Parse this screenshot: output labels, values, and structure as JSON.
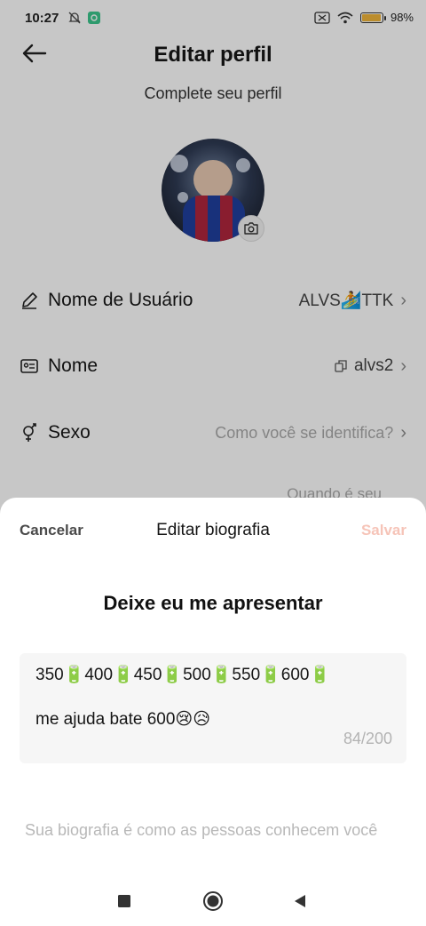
{
  "status_bar": {
    "time": "10:27",
    "battery": "98%",
    "battery_level": 0.98,
    "icons": [
      "mute-bell-icon",
      "app-notification-icon",
      "screen-icon",
      "wifi-icon",
      "battery-icon"
    ]
  },
  "header": {
    "title": "Editar perfil",
    "subtitle": "Complete seu perfil",
    "back_icon": "arrow-left-icon"
  },
  "profile": {
    "camera_icon": "camera-icon",
    "rows": [
      {
        "icon": "pencil-icon",
        "label": "Nome de Usuário",
        "value": "ALVS🏄TTK"
      },
      {
        "icon": "id-card-icon",
        "label": "Nome",
        "value": "alvs2",
        "value_icon": "copy-icon"
      },
      {
        "icon": "gender-icon",
        "label": "Sexo",
        "value": "Como você se identifica?"
      }
    ],
    "partial_row_text": "Quando é seu"
  },
  "sheet": {
    "cancel_label": "Cancelar",
    "title": "Editar biografia",
    "save_label": "Salvar",
    "heading": "Deixe eu me apresentar",
    "bio_line1": "350🔋400🔋450🔋500🔋550🔋600🔋",
    "bio_line2": "me ajuda bate 600😢😥",
    "counter": "84/200",
    "hint": "Sua biografia é como as pessoas conhecem você"
  },
  "nav": {
    "icons": [
      "recent-apps-icon",
      "home-icon",
      "back-icon"
    ]
  },
  "colors": {
    "save_disabled": "#f6c4b8",
    "battery": "#f0b53c"
  }
}
